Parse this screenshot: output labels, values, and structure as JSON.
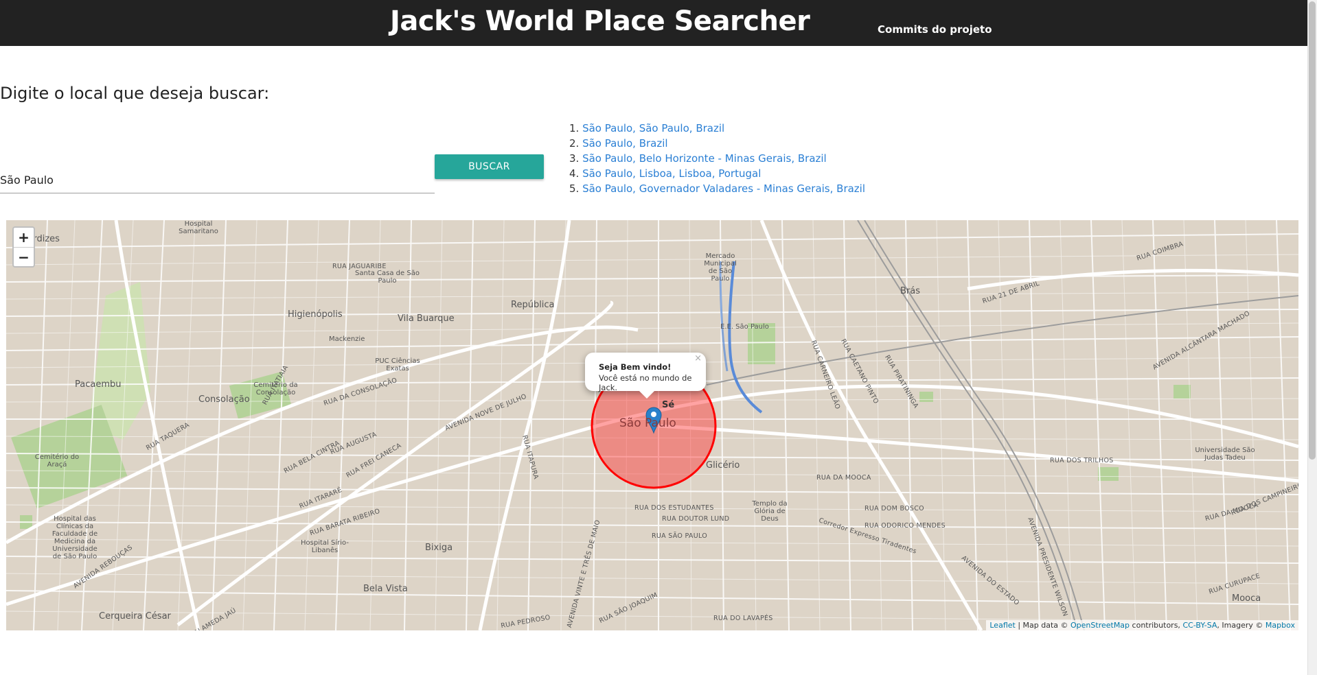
{
  "header": {
    "title": "Jack's World Place Searcher",
    "commits_link": "Commits do projeto"
  },
  "search": {
    "prompt": "Digite o local que deseja buscar:",
    "value": "São Paulo",
    "button_label": "BUSCAR"
  },
  "results": [
    {
      "num": "1.",
      "label": "São Paulo, São Paulo, Brazil"
    },
    {
      "num": "2.",
      "label": "São Paulo, Brazil"
    },
    {
      "num": "3.",
      "label": "São Paulo, Belo Horizonte - Minas Gerais, Brazil"
    },
    {
      "num": "4.",
      "label": "São Paulo, Lisboa, Lisboa, Portugal"
    },
    {
      "num": "5.",
      "label": "São Paulo, Governador Valadares - Minas Gerais, Brazil"
    }
  ],
  "map": {
    "zoom_in": "+",
    "zoom_out": "−",
    "popup": {
      "close": "×",
      "title": "Seja Bem vindo!",
      "text": "Você está no mundo de Jack."
    },
    "attribution": {
      "leaflet": "Leaflet",
      "map_data": " | Map data © ",
      "osm": "OpenStreetMap",
      "contributors": " contributors, ",
      "license": "CC-BY-SA",
      "imagery": ", Imagery © ",
      "mapbox": "Mapbox"
    },
    "marker_icon": "map-pin-icon",
    "circle_color": "#ff3333",
    "labels": {
      "se": "Sé",
      "sao_paulo": "São Paulo",
      "perdizes": "Perdizes",
      "higienopolis": "Higienópolis",
      "vila_buarque": "Vila Buarque",
      "republica": "República",
      "pacaembu": "Pacaembu",
      "consolacao": "Consolação",
      "bras": "Brás",
      "glicerio": "Glicério",
      "bixiga": "Bixiga",
      "bela_vista": "Bela Vista",
      "cerqueira_cesar": "Cerqueira César",
      "mooca": "Mooca",
      "mackenzie": "Mackenzie",
      "mercado": "Mercado Municipal de São Paulo",
      "santa_casa": "Santa Casa de São Paulo",
      "hospital_samaritano": "Hospital Samaritano",
      "puc": "PUC Ciências Exatas",
      "cemiterio_consolacao": "Cemitério da Consolação",
      "cemiterio_araca": "Cemitério do Araçá",
      "hospital_clinicas": "Hospital das Clínicas da Faculdade de Medicina da Universidade de São Paulo",
      "sirio": "Hospital Sírio-Libanês",
      "templo": "Templo da Glória de Deus",
      "ee_sao_paulo": "E.E. São Paulo",
      "universidade": "Universidade São Judas Tadeu",
      "rua_da_consolacao": "RUA DA CONSOLAÇÃO",
      "avenida_nove_de_julho": "AVENIDA NOVE DE JULHO",
      "rua_da_mooca": "RUA DA MOOCA",
      "rua_dos_trilhos": "RUA DOS TRILHOS",
      "rua_dos_estudantes": "RUA DOS ESTUDANTES",
      "rua_doutor_lund": "RUA DOUTOR LUND",
      "rua_sao_paulo": "RUA SÃO PAULO",
      "rua_jaguaribe": "RUA JAGUARIBE",
      "rua_augusta": "RUA AUGUSTA",
      "rua_coimbra": "RUA COIMBRA",
      "rua_dom_bosco": "RUA DOM BOSCO",
      "rua_odorico_mendes": "RUA ODORICO MENDES",
      "rua_da_mooca_2": "RUA DA MOOCA",
      "rua_dos_campineiros": "RUA DOS CAMPINEIROS",
      "avenida_alcantara_machado": "AVENIDA ALCÂNTARA MACHADO",
      "corredor": "Corredor Expresso Tiradentes",
      "avenida_do_estado": "AVENIDA DO ESTADO",
      "rua_frei_caneca": "RUA FREI CANECA",
      "rua_itapura": "RUA ITAPURA",
      "rua_bela_cintra": "RUA BELA CINTRA",
      "rua_itarare": "RUA ITARARÉ",
      "rua_barata_ribeiro": "RUA BARATA RIBEIRO",
      "rua_itatiaia": "RUA ITATIAIA",
      "rua_taquera": "RUA TAQUERA",
      "avenida_reboucas": "AVENIDA REBOUÇAS",
      "alameda_jau": "ALAMEDA JAÚ",
      "rua_pedroso": "RUA PEDROSO",
      "rua_sao_joaquim": "RUA SÃO JOAQUIM",
      "avenida_vinte_e_tres": "AVENIDA VINTE E TRÊS DE MAIO",
      "rua_do_lavapes": "RUA DO LAVAPÉS",
      "rua_curupace": "RUA CURUPACE",
      "rua_21_de_abril": "RUA 21 DE ABRIL",
      "avenida_presidente": "AVENIDA PRESIDENTE WILSON",
      "rua_carneiro_leao": "RUA CARNEIRO LEÃO",
      "rua_caetano_pinto": "RUA CAETANO PINTO",
      "rua_piratininga": "RUA PIRATININGA"
    }
  }
}
